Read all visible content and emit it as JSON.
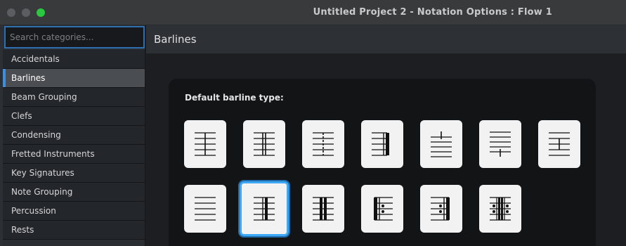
{
  "window": {
    "title": "Untitled Project 2 - Notation Options : Flow 1"
  },
  "search": {
    "placeholder": "Search categories..."
  },
  "sidebar": {
    "items": [
      {
        "label": "Accidentals"
      },
      {
        "label": "Barlines",
        "selected": true
      },
      {
        "label": "Beam Grouping"
      },
      {
        "label": "Clefs"
      },
      {
        "label": "Condensing"
      },
      {
        "label": "Fretted Instruments"
      },
      {
        "label": "Key Signatures"
      },
      {
        "label": "Note Grouping"
      },
      {
        "label": "Percussion"
      },
      {
        "label": "Rests"
      }
    ]
  },
  "main": {
    "title": "Barlines",
    "default_barline_label": "Default barline type:",
    "barline_options": [
      {
        "icon": "normal-barline-icon"
      },
      {
        "icon": "double-barline-icon"
      },
      {
        "icon": "dashed-barline-icon"
      },
      {
        "icon": "final-barline-icon"
      },
      {
        "icon": "tick-barline-icon"
      },
      {
        "icon": "short-barline-icon"
      },
      {
        "icon": "thick-barline-icon"
      },
      {
        "icon": "invisible-barline-icon"
      },
      {
        "icon": "heavy-heavy-barline-icon",
        "selected": true
      },
      {
        "icon": "thin-thick-thin-barline-icon"
      },
      {
        "icon": "start-repeat-barline-icon"
      },
      {
        "icon": "end-repeat-barline-icon"
      },
      {
        "icon": "end-start-repeat-barline-icon"
      }
    ]
  },
  "colors": {
    "accent": "#3ea8f5",
    "selected_row": "#4a4d52",
    "close_light": "#5b5d60",
    "zoom_light": "#2ac840"
  }
}
